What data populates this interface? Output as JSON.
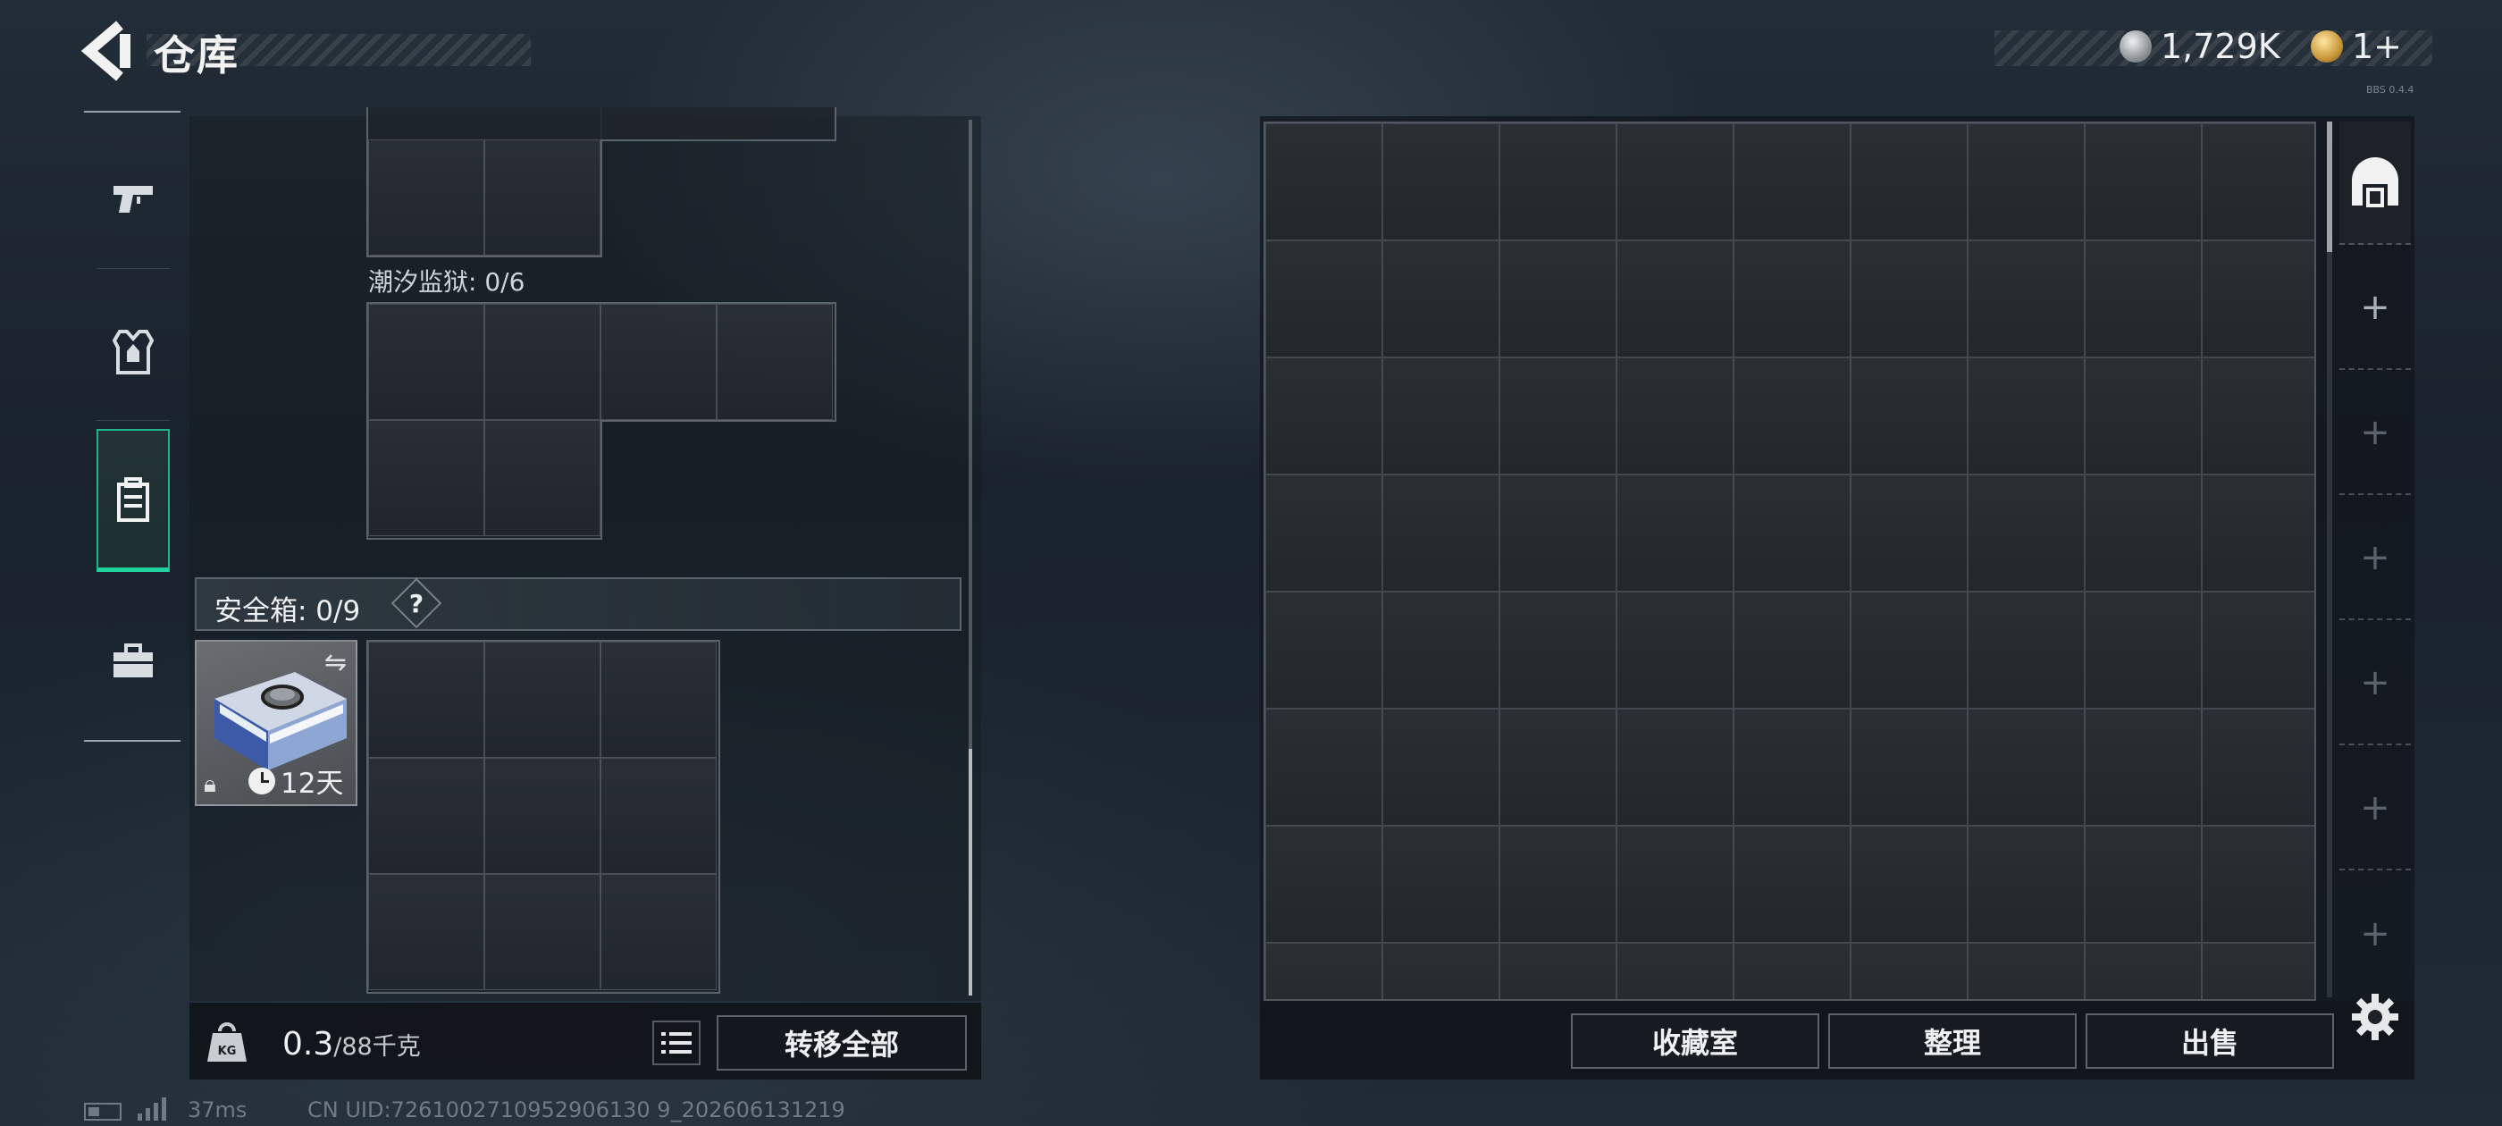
{
  "header": {
    "title": "仓库",
    "currencies": [
      {
        "icon": "silver-coin-icon",
        "value": "1,729K"
      },
      {
        "icon": "gold-coin-icon",
        "value": "1+"
      }
    ],
    "version": "BBS 0.4.4"
  },
  "sidebar": {
    "items": [
      {
        "icon": "pistol-icon",
        "active": false
      },
      {
        "icon": "armor-vest-icon",
        "active": false
      },
      {
        "icon": "backpack-icon",
        "active": true
      },
      {
        "icon": "toolbox-icon",
        "active": false
      }
    ]
  },
  "loadout": {
    "prison_label": "潮汐监狱: 0/6",
    "safebox_label": "安全箱: 0/9",
    "safebox_help": "?",
    "safebox_item": {
      "timer": "12天",
      "locked": true
    },
    "weight_value": "0.3",
    "weight_capacity": "/88千克",
    "transfer_all": "转移全部"
  },
  "stash": {
    "tabs": [
      "warehouse-icon",
      "+",
      "+",
      "+",
      "+",
      "+",
      "+"
    ],
    "buttons": {
      "collection": "收藏室",
      "sort": "整理",
      "sell": "出售"
    }
  },
  "status": {
    "ping": "37ms",
    "uid": "CN UID:7261002710952906130 9_202606131219"
  },
  "colors": {
    "accent": "#1fd49c",
    "panel": "#1a1f24"
  }
}
